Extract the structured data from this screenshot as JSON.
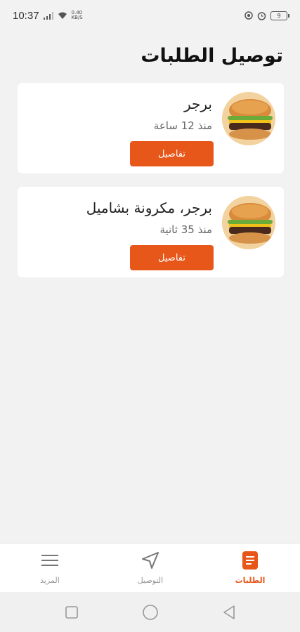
{
  "status_bar": {
    "time": "10:37",
    "net_speed_value": "0.40",
    "net_speed_unit": "KB/S",
    "battery": "9"
  },
  "page": {
    "title": "توصيل الطلبات"
  },
  "orders": [
    {
      "title": "برجر",
      "time": "منذ 12 ساعة",
      "button": "تفاصيل"
    },
    {
      "title": "برجر، مكرونة بشاميل",
      "time": "منذ 35 ثانية",
      "button": "تفاصيل"
    }
  ],
  "bottom_nav": {
    "items": [
      {
        "label": "الطلبات",
        "icon": "orders-icon",
        "active": true
      },
      {
        "label": "التوصيل",
        "icon": "navigation-arrow-icon",
        "active": false
      },
      {
        "label": "المزيد",
        "icon": "menu-icon",
        "active": false
      }
    ]
  },
  "colors": {
    "accent": "#e8571a",
    "background": "#f2f2f2",
    "card": "#ffffff"
  }
}
